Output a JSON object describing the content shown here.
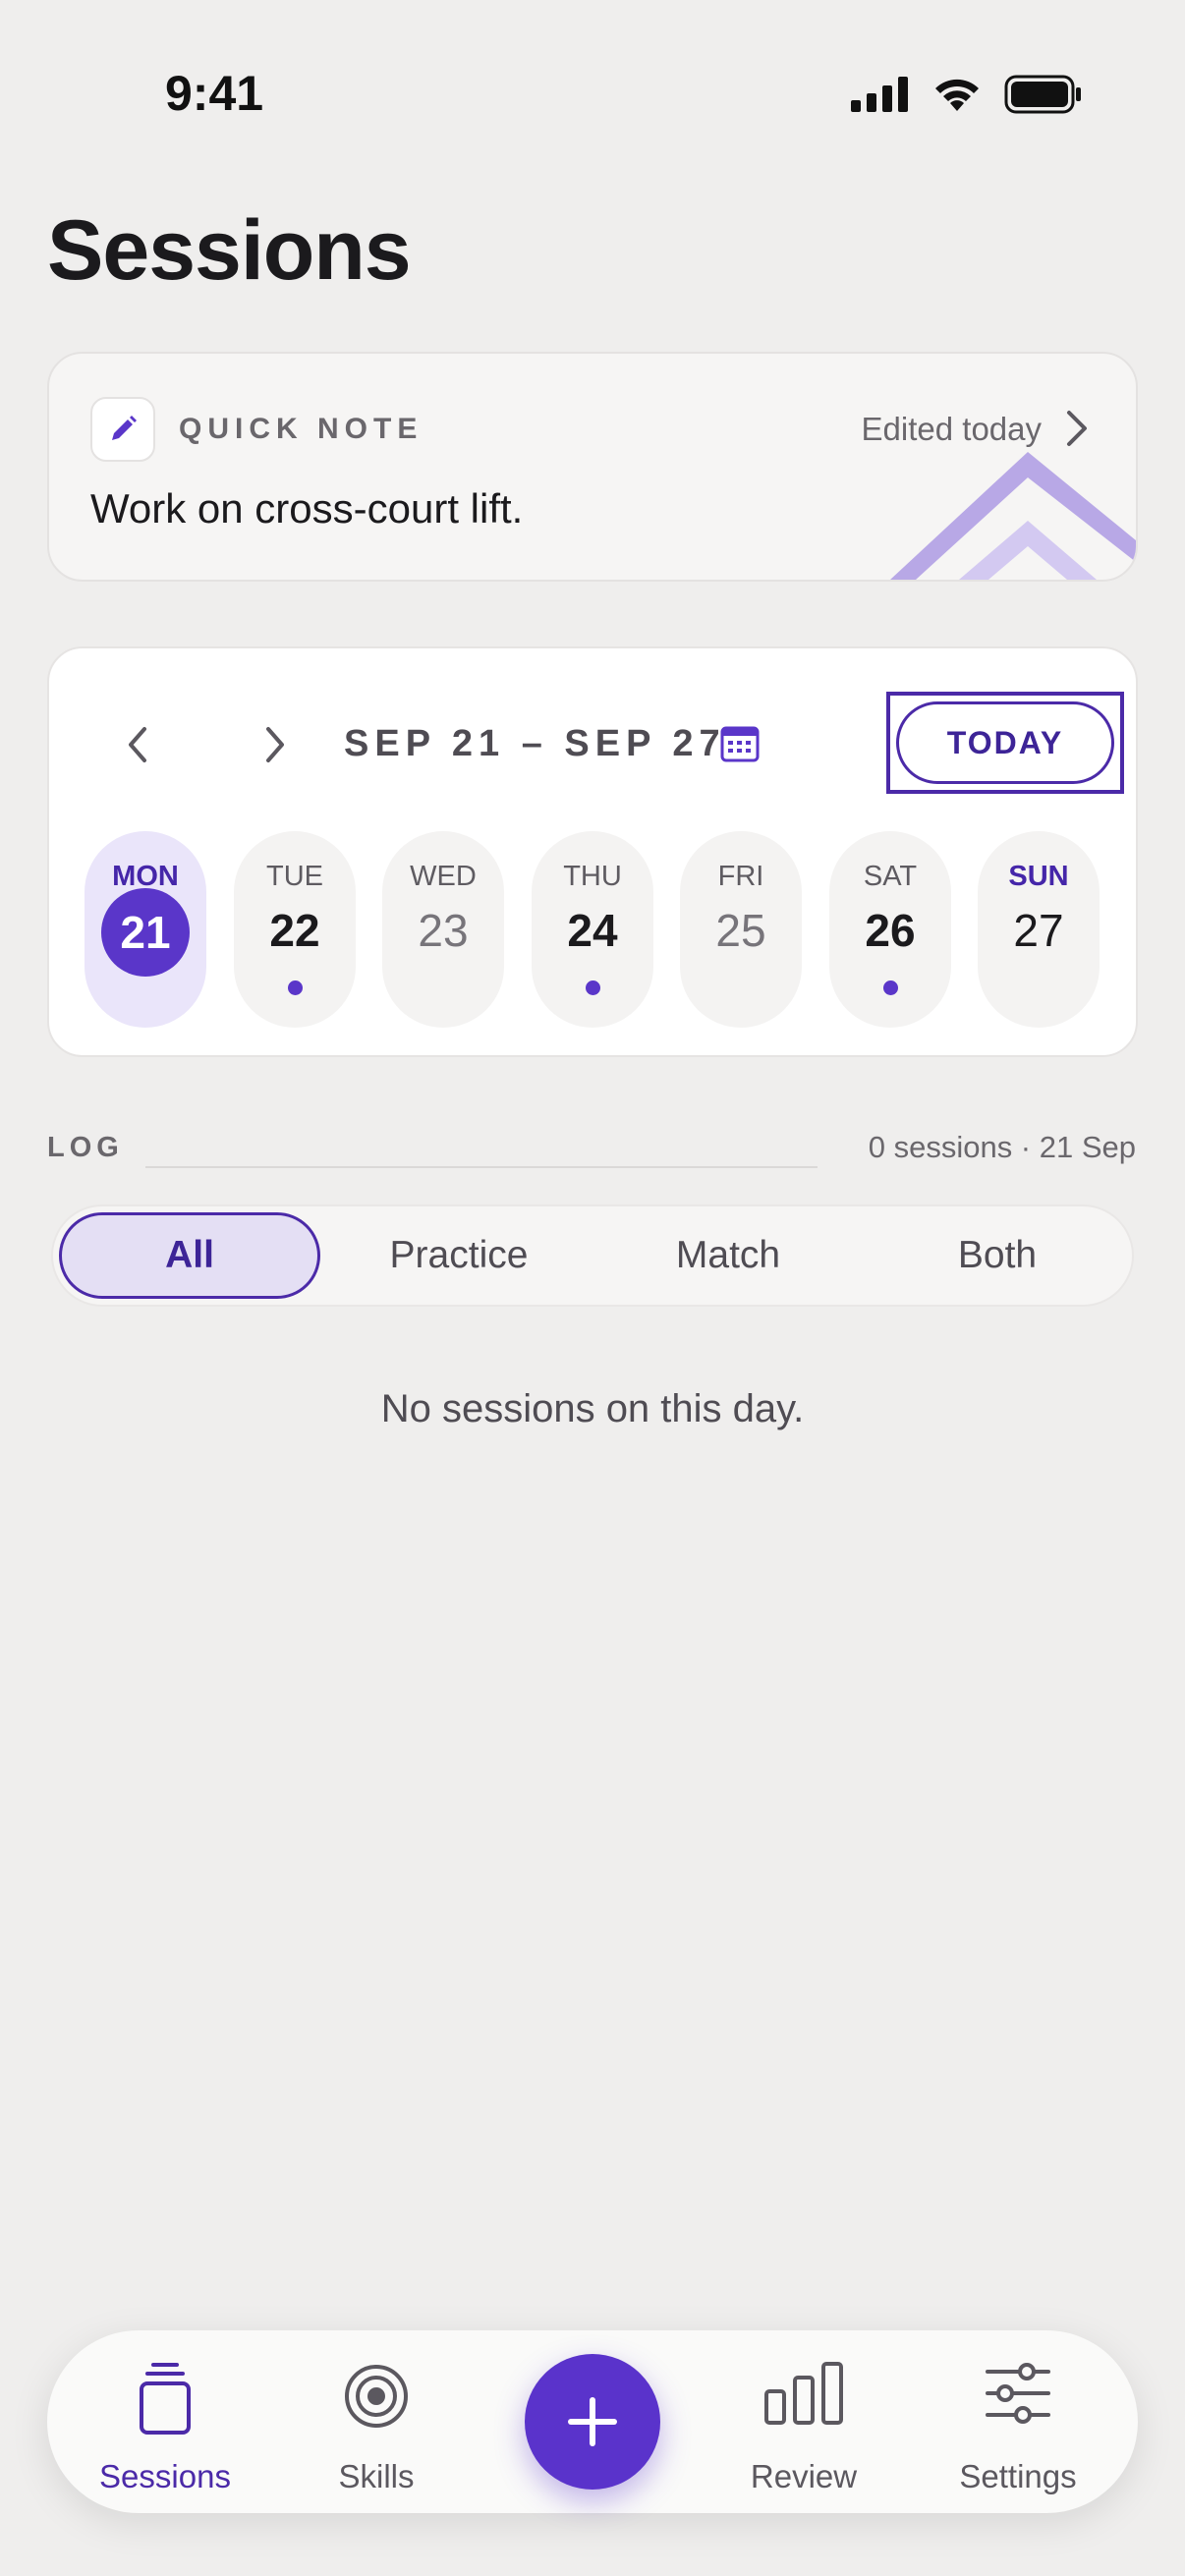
{
  "status_bar": {
    "time": "9:41"
  },
  "header": {
    "title": "Sessions"
  },
  "quick_note": {
    "label": "QUICK NOTE",
    "edited": "Edited today",
    "text": "Work on cross-court lift."
  },
  "week": {
    "range": "SEP 21 – SEP 27",
    "today_label": "TODAY",
    "days": [
      {
        "name": "MON",
        "num": "21",
        "selected": true,
        "has_session": false
      },
      {
        "name": "TUE",
        "num": "22",
        "selected": false,
        "has_session": true
      },
      {
        "name": "WED",
        "num": "23",
        "selected": false,
        "has_session": false
      },
      {
        "name": "THU",
        "num": "24",
        "selected": false,
        "has_session": true
      },
      {
        "name": "FRI",
        "num": "25",
        "selected": false,
        "has_session": false
      },
      {
        "name": "SAT",
        "num": "26",
        "selected": false,
        "has_session": true
      },
      {
        "name": "SUN",
        "num": "27",
        "selected": false,
        "has_session": false
      }
    ]
  },
  "log": {
    "label": "LOG",
    "count": "0 sessions · 21 Sep",
    "filters": [
      "All",
      "Practice",
      "Match",
      "Both"
    ],
    "active_filter": "All",
    "empty_message": "No sessions on this day."
  },
  "tabbar": {
    "tabs": [
      {
        "label": "Sessions",
        "icon": "sessions-icon",
        "active": true
      },
      {
        "label": "Skills",
        "icon": "target-icon",
        "active": false
      },
      {
        "label": "Review",
        "icon": "bar-chart-icon",
        "active": false
      },
      {
        "label": "Settings",
        "icon": "sliders-icon",
        "active": false
      }
    ],
    "fab_icon": "plus-icon"
  },
  "colors": {
    "accent": "#5A36C9",
    "accent_dark": "#4B2AA8",
    "background": "#EFEEED"
  }
}
